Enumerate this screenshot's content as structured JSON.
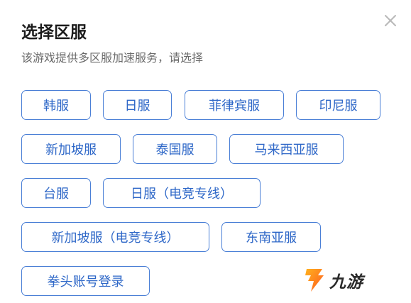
{
  "dialog": {
    "title": "选择区服",
    "subtitle": "该游戏提供多区服加速服务，请选择",
    "close_icon": "close-icon"
  },
  "regions": [
    {
      "label": "韩服"
    },
    {
      "label": "日服"
    },
    {
      "label": "菲律宾服"
    },
    {
      "label": "印尼服"
    },
    {
      "label": "新加坡服"
    },
    {
      "label": "泰国服"
    },
    {
      "label": "马来西亚服"
    },
    {
      "label": "台服"
    },
    {
      "label": "日服（电竞专线）"
    },
    {
      "label": "新加坡服（电竞专线）"
    },
    {
      "label": "东南亚服"
    },
    {
      "label": "拳头账号登录"
    }
  ],
  "watermark": {
    "text": "九游",
    "icon": "jiuyou-logo-icon"
  },
  "colors": {
    "accent": "#2f68c8",
    "border": "#4a7fd6",
    "title": "#1c1c1c",
    "subtitle": "#6b6b6b"
  }
}
